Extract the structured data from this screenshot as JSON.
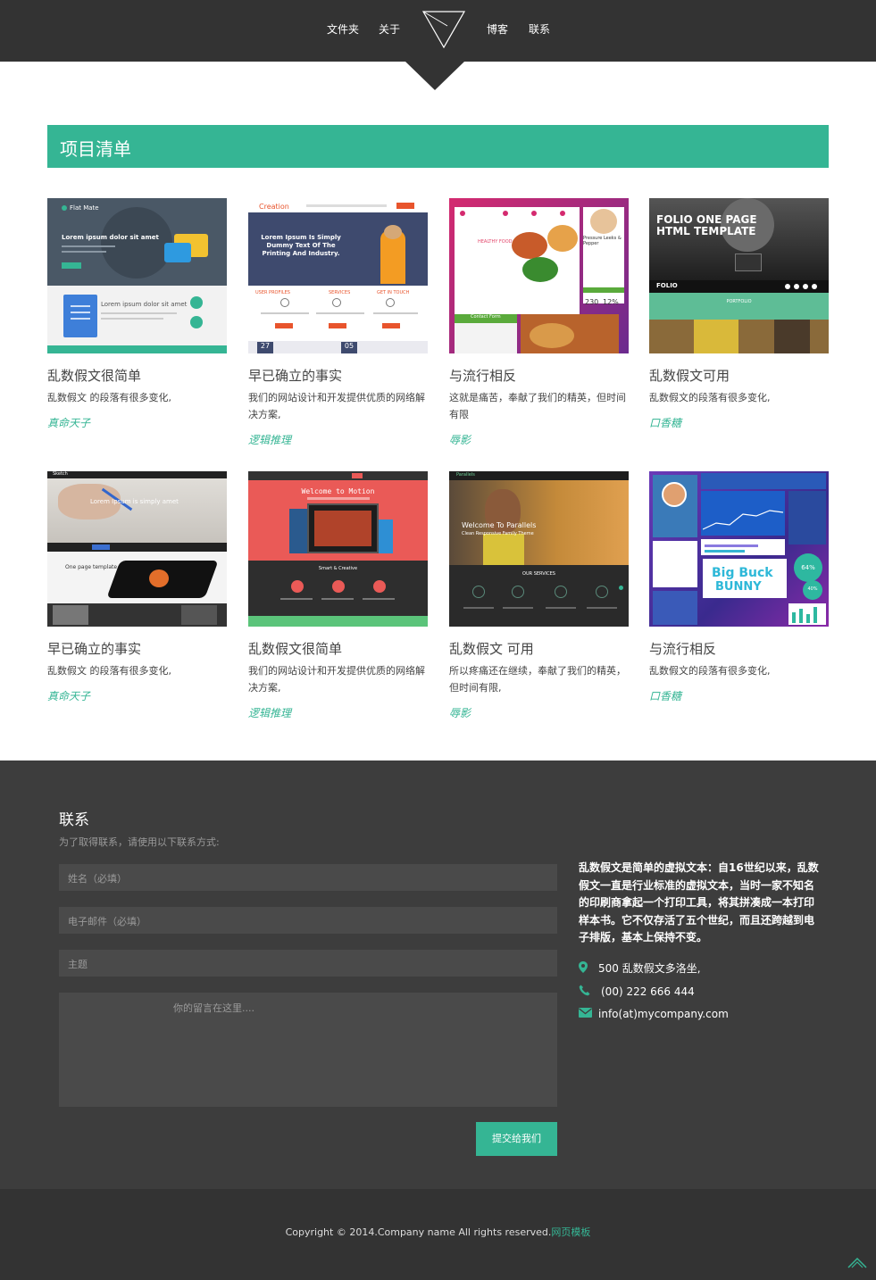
{
  "nav": {
    "items": [
      "文件夹",
      "关于",
      "博客",
      "联系"
    ]
  },
  "portfolio": {
    "title": "项目清单",
    "cards": [
      {
        "title": "乱数假文很简单",
        "desc": "乱数假文 的段落有很多变化,",
        "tag": "真命天子"
      },
      {
        "title": "早已确立的事实",
        "desc": "我们的网站设计和开发提供优质的网络解决方案,",
        "tag": "逻辑推理"
      },
      {
        "title": "与流行相反",
        "desc": "这就是痛苦，奉献了我们的精英，但时间有限",
        "tag": "辱影"
      },
      {
        "title": "乱数假文可用",
        "desc": "乱数假文的段落有很多变化,",
        "tag": "口香糖"
      },
      {
        "title": "早已确立的事实",
        "desc": "乱数假文 的段落有很多变化,",
        "tag": "真命天子"
      },
      {
        "title": "乱数假文很简单",
        "desc": "我们的网站设计和开发提供优质的网络解决方案,",
        "tag": "逻辑推理"
      },
      {
        "title": "乱数假文  可用",
        "desc": "所以疼痛还在继续，奉献了我们的精英，但时间有限,",
        "tag": "辱影"
      },
      {
        "title": "与流行相反",
        "desc": "乱数假文的段落有很多变化,",
        "tag": "口香糖"
      }
    ],
    "thumbs": {
      "t1": {
        "brand": "Flat Mate",
        "headline": "Lorem ipsum dolor sit amet",
        "headline2": "Lorem ipsum dolor sit amet"
      },
      "t2": {
        "brand": "Creation",
        "headline": "Lorem Ipsum Is Simply Dummy Text Of The Printing And Industry.",
        "col1": "USER PROFILES",
        "col2": "SERVICES",
        "col3": "GET IN TOUCH",
        "n1": "27",
        "n2": "05"
      },
      "t3": {
        "brand": "HEALTHY FOOD",
        "side": "Pressure Leeks & Pepper",
        "n1": "230",
        "n2": "12%",
        "contact": "Contact Form"
      },
      "t4": {
        "headline": "FOLIO ONE PAGE HTML TEMPLATE",
        "logo": "FOLIO",
        "sub": "PORTFOLIO"
      },
      "t5": {
        "brand": "Sketch",
        "headline": "Lorem Ipsum is simply amet",
        "sub": "One page template"
      },
      "t6": {
        "headline": "Welcome to Motion",
        "sub": "Smart & Creative"
      },
      "t7": {
        "brand": "Parallels",
        "headline": "Welcome To Parallels",
        "sub": "Clean Responsive Family Theme",
        "services": "OUR SERVICES"
      },
      "t8": {
        "big1": "Big Buck",
        "big2": "BUNNY",
        "p1": "64%",
        "p2": "40%"
      }
    }
  },
  "contact": {
    "title": "联系",
    "subtitle": "为了取得联系，请使用以下联系方式:",
    "name_ph": "姓名（必填）",
    "email_ph": "电子邮件（必填）",
    "subject_ph": "主题",
    "message_ph": "你的留言在这里....",
    "submit": "提交给我们",
    "about": "乱数假文是简单的虚拟文本：自16世纪以来，乱数假文一直是行业标准的虚拟文本，当时一家不知名的印刷商拿起一个打印工具，将其拼凑成一本打印样本书。它不仅存活了五个世纪，而且还跨越到电子排版，基本上保持不变。",
    "address": "500 乱数假文多洛坐,",
    "phone": "(00) 222 666 444",
    "email": "info(at)mycompany.com"
  },
  "footer": {
    "copyright": "Copyright © 2014.Company name All rights reserved.",
    "link": "网页模板"
  },
  "colors": {
    "accent": "#35b594",
    "dark": "#333333",
    "contact_bg": "#3d3d3d"
  }
}
